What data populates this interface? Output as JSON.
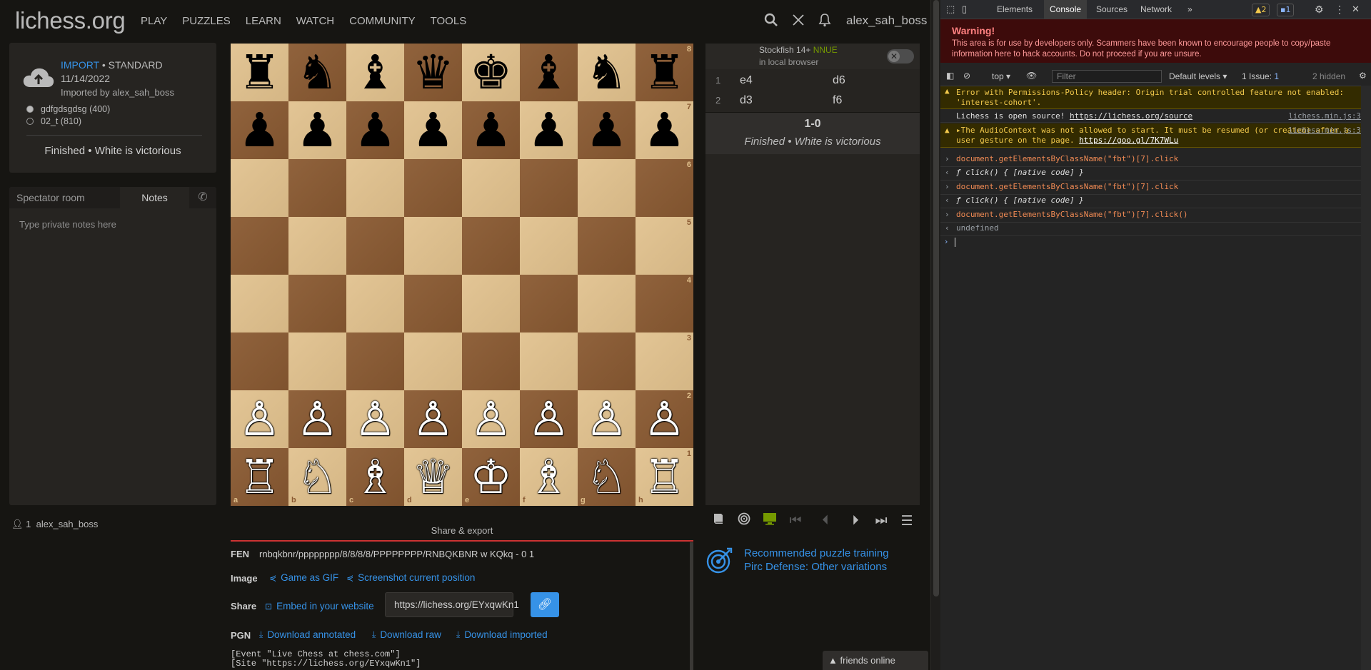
{
  "app": {
    "logo": "lichess.org",
    "nav": [
      "PLAY",
      "PUZZLES",
      "LEARN",
      "WATCH",
      "COMMUNITY",
      "TOOLS"
    ],
    "username": "alex_sah_boss"
  },
  "game_info": {
    "import_link": "IMPORT",
    "variant": " • STANDARD",
    "date": "11/14/2022",
    "imported_by": "Imported by alex_sah_boss",
    "white_player": "gdfgdsgdsg (400)",
    "black_player": "02_t (810)",
    "status": "Finished • White is victorious"
  },
  "chat": {
    "tab_spectator": "Spectator room",
    "tab_notes": "Notes",
    "notes_placeholder": "Type private notes here"
  },
  "watchers": {
    "count": "1",
    "name": "alex_sah_boss"
  },
  "board": {
    "ranks": [
      "8",
      "7",
      "6",
      "5",
      "4",
      "3",
      "2",
      "1"
    ],
    "files": [
      "a",
      "b",
      "c",
      "d",
      "e",
      "f",
      "g",
      "h"
    ],
    "position": [
      [
        "♜",
        "♞",
        "♝",
        "♛",
        "♚",
        "♝",
        "♞",
        "♜"
      ],
      [
        "♟",
        "♟",
        "♟",
        "♟",
        "♟",
        "♟",
        "♟",
        "♟"
      ],
      [
        "",
        "",
        "",
        "",
        "",
        "",
        "",
        ""
      ],
      [
        "",
        "",
        "",
        "",
        "",
        "",
        "",
        ""
      ],
      [
        "",
        "",
        "",
        "",
        "",
        "",
        "",
        ""
      ],
      [
        "",
        "",
        "",
        "",
        "",
        "",
        "",
        ""
      ],
      [
        "♙",
        "♙",
        "♙",
        "♙",
        "♙",
        "♙",
        "♙",
        "♙"
      ],
      [
        "♖",
        "♘",
        "♗",
        "♕",
        "♔",
        "♗",
        "♘",
        "♖"
      ]
    ]
  },
  "engine": {
    "name": "Stockfish 14+",
    "nnue": "NNUE",
    "subtitle": "in local browser"
  },
  "moves": [
    {
      "index": "1",
      "white": "e4",
      "black": "d6"
    },
    {
      "index": "2",
      "white": "d3",
      "black": "f6"
    }
  ],
  "result": {
    "score": "1-0",
    "text": "Finished • White is victorious"
  },
  "controls": [
    "book-icon",
    "target-icon",
    "monitor-icon",
    "first-icon",
    "prev-icon",
    "next-icon",
    "last-icon",
    "menu-icon"
  ],
  "puzzle": {
    "line1": "Recommended puzzle training",
    "line2": "Pirc Defense: Other variations"
  },
  "share": {
    "title": "Share & export",
    "fen_label": "FEN",
    "fen": "rnbqkbnr/pppppppp/8/8/8/8/PPPPPPPP/RNBQKBNR w KQkq - 0 1",
    "image_label": "Image",
    "gif": "Game as GIF",
    "screenshot": "Screenshot current position",
    "share_label": "Share",
    "embed": "Embed in your website",
    "url": "https://lichess.org/EYxqwKn1",
    "pgn_label": "PGN",
    "dl_annotated": "Download annotated",
    "dl_raw": "Download raw",
    "dl_imported": "Download imported",
    "pgn_line1": "[Event \"Live Chess at chess.com\"]",
    "pgn_line2": "[Site \"https://lichess.org/EYxqwKn1\"]"
  },
  "friends": "friends online",
  "devtools": {
    "tabs": [
      "Elements",
      "Console",
      "Sources",
      "Network"
    ],
    "warn_count": "2",
    "msg_count": "1",
    "warning_title": "Warning!",
    "warning_text": "This area is for use by developers only. Scammers have been known to encourage people to copy/paste information here to hack accounts. Do not proceed if you are unsure.",
    "context": "top",
    "filter_placeholder": "Filter",
    "levels": "Default levels",
    "issues": "1 Issue:",
    "issues_count": "1",
    "hidden": "2 hidden",
    "log": [
      {
        "type": "warn",
        "text": "Error with Permissions-Policy header: Origin trial controlled feature not enabled: 'interest-cohort'.",
        "src": ""
      },
      {
        "type": "plain",
        "text": "Lichess is open source! ",
        "link": "https://lichess.org/source",
        "src": "lichess.min.js:36"
      },
      {
        "type": "warn",
        "text": "▸The AudioContext was not allowed to start. It must be resumed (or created) after a user gesture on the page. ",
        "link": "https://goo.gl/7K7WLu",
        "src": "lichess.min.js:35"
      },
      {
        "type": "input",
        "text": "document.getElementsByClassName(\"fbt\")[7].click"
      },
      {
        "type": "output",
        "text": "ƒ click() { [native code] }"
      },
      {
        "type": "input",
        "text": "document.getElementsByClassName(\"fbt\")[7].click"
      },
      {
        "type": "output",
        "text": "ƒ click() { [native code] }"
      },
      {
        "type": "input",
        "text": "document.getElementsByClassName(\"fbt\")[7].click()"
      },
      {
        "type": "undef",
        "text": "undefined"
      }
    ]
  }
}
